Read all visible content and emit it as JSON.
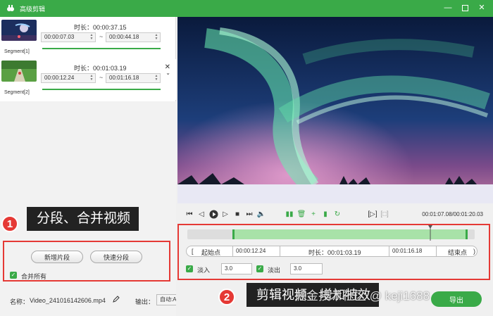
{
  "window": {
    "title": "高级剪辑"
  },
  "segments": [
    {
      "name": "Segment[1]",
      "duration": "时长：00:00:37.15",
      "start": "00:00:07.03",
      "end": "00:00:44.18"
    },
    {
      "name": "Segment[2]",
      "duration": "时长：00:01:03.19",
      "start": "00:00:12.24",
      "end": "00:01:16.18"
    }
  ],
  "annotations": {
    "one": {
      "num": "1",
      "text": "分段、合并视频"
    },
    "two": {
      "num": "2",
      "text": "剪辑视频、增加特效"
    }
  },
  "left_panel": {
    "new_segment": "新增片段",
    "quick_split": "快速分段",
    "merge_all": "合并所有",
    "name_label": "名称：",
    "file_name": "Video_241016142606.mp4",
    "output_label": "输出：",
    "output_value": "自动:Auto"
  },
  "player": {
    "timecode": "00:01:07.08/00:01:20.03"
  },
  "editor": {
    "start_point": "起始点",
    "start_time": "00:00:12.24",
    "duration": "时长：00:01:03.19",
    "end_time": "00:01:16.18",
    "end_point": "结束点",
    "fade_in_label": "淡入",
    "fade_in_value": "3.0",
    "fade_out_label": "淡出",
    "fade_out_value": "3.0"
  },
  "watermark": "掘金技术社区 @ keji1688",
  "export_label": "导出",
  "colors": {
    "brand_green": "#3aaa48",
    "annotation_red": "#e53935"
  }
}
